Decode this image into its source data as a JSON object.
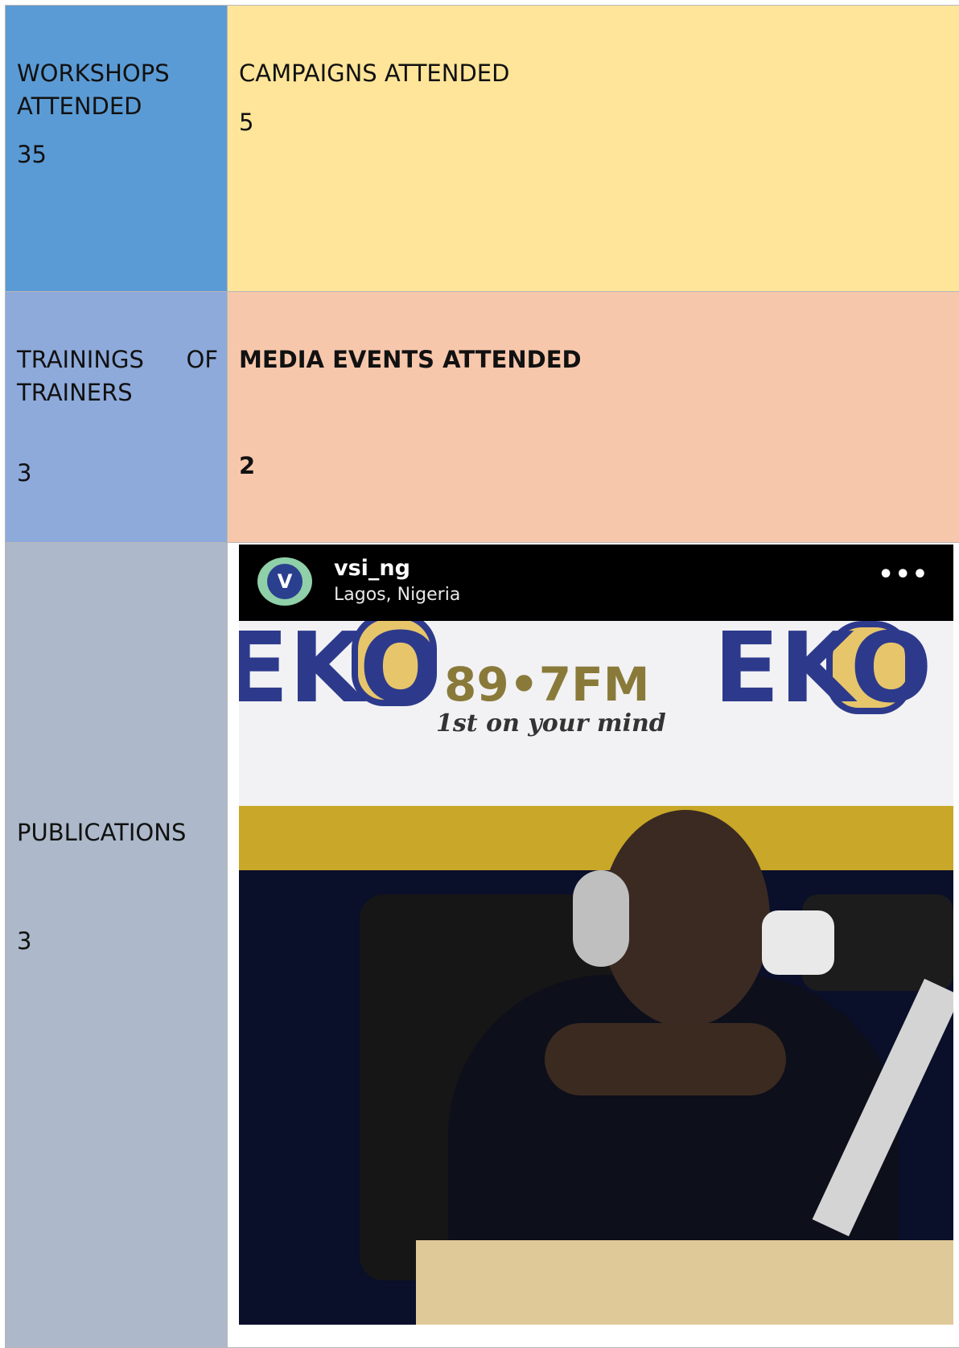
{
  "cells": {
    "workshops": {
      "label": "WORKSHOPS ATTENDED",
      "value": "35"
    },
    "campaigns": {
      "label": "CAMPAIGNS ATTENDED",
      "value": "5"
    },
    "trainings": {
      "label": "TRAININGS OF TRAINERS",
      "value": "3"
    },
    "media": {
      "label": "MEDIA EVENTS ATTENDED",
      "value": "2"
    },
    "publications": {
      "label": "PUBLICATIONS",
      "value": "3"
    }
  },
  "post": {
    "avatar_letter": "V",
    "username": "vsi_ng",
    "location": "Lagos, Nigeria",
    "more": "•••",
    "photo": {
      "banner_brand": "EKO",
      "banner_frequency": "89•7FM",
      "banner_tagline": "1st on your mind"
    },
    "icons": {
      "more": "more-options-icon",
      "user_tag": "user-tag-icon"
    }
  },
  "colors": {
    "workshops_bg": "#5b9bd5",
    "campaigns_bg": "#ffe599",
    "trainings_bg": "#8eaadb",
    "media_bg": "#f7c7ac",
    "publications_bg": "#adb9ca"
  }
}
